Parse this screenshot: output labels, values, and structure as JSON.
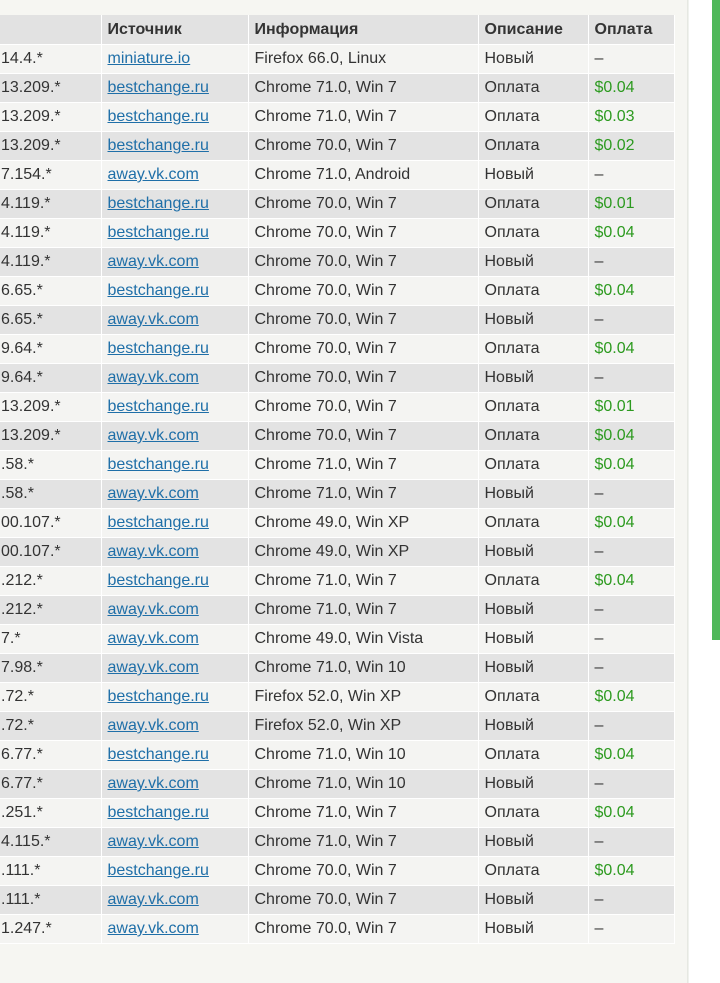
{
  "table": {
    "headers": {
      "ip": "",
      "source": "Источник",
      "info": "Информация",
      "description": "Описание",
      "payment": "Оплата"
    },
    "rows": [
      {
        "ip": "14.4.*",
        "source": "miniature.io",
        "info": "Firefox 66.0, Linux",
        "description": "Новый",
        "payment": "–"
      },
      {
        "ip": "13.209.*",
        "source": "bestchange.ru",
        "info": "Chrome 71.0, Win 7",
        "description": "Оплата",
        "payment": "$0.04"
      },
      {
        "ip": "13.209.*",
        "source": "bestchange.ru",
        "info": "Chrome 71.0, Win 7",
        "description": "Оплата",
        "payment": "$0.03"
      },
      {
        "ip": "13.209.*",
        "source": "bestchange.ru",
        "info": "Chrome 70.0, Win 7",
        "description": "Оплата",
        "payment": "$0.02"
      },
      {
        "ip": "7.154.*",
        "source": "away.vk.com",
        "info": "Chrome 71.0, Android",
        "description": "Новый",
        "payment": "–"
      },
      {
        "ip": "4.119.*",
        "source": "bestchange.ru",
        "info": "Chrome 70.0, Win 7",
        "description": "Оплата",
        "payment": "$0.01"
      },
      {
        "ip": "4.119.*",
        "source": "bestchange.ru",
        "info": "Chrome 70.0, Win 7",
        "description": "Оплата",
        "payment": "$0.04"
      },
      {
        "ip": "4.119.*",
        "source": "away.vk.com",
        "info": "Chrome 70.0, Win 7",
        "description": "Новый",
        "payment": "–"
      },
      {
        "ip": "6.65.*",
        "source": "bestchange.ru",
        "info": "Chrome 70.0, Win 7",
        "description": "Оплата",
        "payment": "$0.04"
      },
      {
        "ip": "6.65.*",
        "source": "away.vk.com",
        "info": "Chrome 70.0, Win 7",
        "description": "Новый",
        "payment": "–"
      },
      {
        "ip": "9.64.*",
        "source": "bestchange.ru",
        "info": "Chrome 70.0, Win 7",
        "description": "Оплата",
        "payment": "$0.04"
      },
      {
        "ip": "9.64.*",
        "source": "away.vk.com",
        "info": "Chrome 70.0, Win 7",
        "description": "Новый",
        "payment": "–"
      },
      {
        "ip": "13.209.*",
        "source": "bestchange.ru",
        "info": "Chrome 70.0, Win 7",
        "description": "Оплата",
        "payment": "$0.01"
      },
      {
        "ip": "13.209.*",
        "source": "away.vk.com",
        "info": "Chrome 70.0, Win 7",
        "description": "Оплата",
        "payment": "$0.04"
      },
      {
        "ip": ".58.*",
        "source": "bestchange.ru",
        "info": "Chrome 71.0, Win 7",
        "description": "Оплата",
        "payment": "$0.04"
      },
      {
        "ip": ".58.*",
        "source": "away.vk.com",
        "info": "Chrome 71.0, Win 7",
        "description": "Новый",
        "payment": "–"
      },
      {
        "ip": "00.107.*",
        "source": "bestchange.ru",
        "info": "Chrome 49.0, Win XP",
        "description": "Оплата",
        "payment": "$0.04"
      },
      {
        "ip": "00.107.*",
        "source": "away.vk.com",
        "info": "Chrome 49.0, Win XP",
        "description": "Новый",
        "payment": "–"
      },
      {
        "ip": ".212.*",
        "source": "bestchange.ru",
        "info": "Chrome 71.0, Win 7",
        "description": "Оплата",
        "payment": "$0.04"
      },
      {
        "ip": ".212.*",
        "source": "away.vk.com",
        "info": "Chrome 71.0, Win 7",
        "description": "Новый",
        "payment": "–"
      },
      {
        "ip": "7.*",
        "source": "away.vk.com",
        "info": "Chrome 49.0, Win Vista",
        "description": "Новый",
        "payment": "–"
      },
      {
        "ip": "7.98.*",
        "source": "away.vk.com",
        "info": "Chrome 71.0, Win 10",
        "description": "Новый",
        "payment": "–"
      },
      {
        "ip": ".72.*",
        "source": "bestchange.ru",
        "info": "Firefox 52.0, Win XP",
        "description": "Оплата",
        "payment": "$0.04"
      },
      {
        "ip": ".72.*",
        "source": "away.vk.com",
        "info": "Firefox 52.0, Win XP",
        "description": "Новый",
        "payment": "–"
      },
      {
        "ip": "6.77.*",
        "source": "bestchange.ru",
        "info": "Chrome 71.0, Win 10",
        "description": "Оплата",
        "payment": "$0.04"
      },
      {
        "ip": "6.77.*",
        "source": "away.vk.com",
        "info": "Chrome 71.0, Win 10",
        "description": "Новый",
        "payment": "–"
      },
      {
        "ip": ".251.*",
        "source": "bestchange.ru",
        "info": "Chrome 71.0, Win 7",
        "description": "Оплата",
        "payment": "$0.04"
      },
      {
        "ip": "4.115.*",
        "source": "away.vk.com",
        "info": "Chrome 71.0, Win 7",
        "description": "Новый",
        "payment": "–"
      },
      {
        "ip": ".111.*",
        "source": "bestchange.ru",
        "info": "Chrome 70.0, Win 7",
        "description": "Оплата",
        "payment": "$0.04"
      },
      {
        "ip": ".111.*",
        "source": "away.vk.com",
        "info": "Chrome 70.0, Win 7",
        "description": "Новый",
        "payment": "–"
      },
      {
        "ip": "1.247.*",
        "source": "away.vk.com",
        "info": "Chrome 70.0, Win 7",
        "description": "Новый",
        "payment": "–"
      }
    ]
  },
  "colors": {
    "link": "#1f6fa8",
    "money": "#2c9a1f",
    "header_bg": "#e2e2e2",
    "row_odd": "#f4f4f2",
    "row_even": "#e3e3e3",
    "accent_bar": "#4fb85a"
  }
}
